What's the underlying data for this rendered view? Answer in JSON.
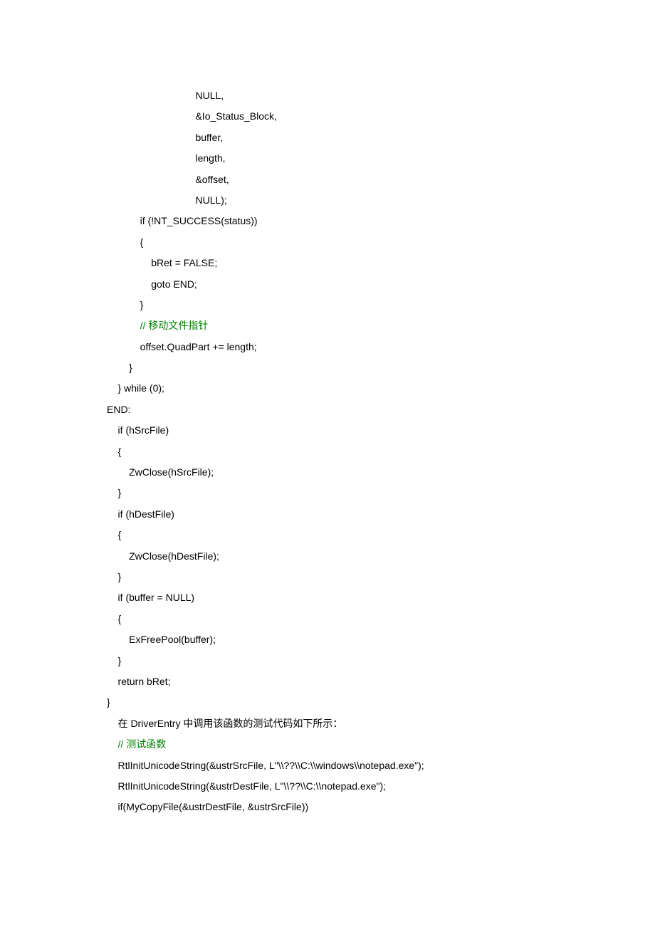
{
  "code": {
    "l1": "                                NULL,",
    "l2": "                                &Io_Status_Block,",
    "l3": "                                buffer,",
    "l4": "                                length,",
    "l5": "                                &offset,",
    "l6": "                                NULL);",
    "l7": "            if (!NT_SUCCESS(status))",
    "l8": "            {",
    "l9": "                bRet = FALSE;",
    "l10": "                goto END;",
    "l11": "            }",
    "l12": "",
    "l13a": "            ",
    "l13b": "// 移动文件指针",
    "l14": "            offset.QuadPart += length;",
    "l15": "        }",
    "l16": "    } while (0);",
    "l17": "END:",
    "l18": "    if (hSrcFile)",
    "l19": "    {",
    "l20": "        ZwClose(hSrcFile);",
    "l21": "    }",
    "l22": "    if (hDestFile)",
    "l23": "    {",
    "l24": "        ZwClose(hDestFile);",
    "l25": "    }",
    "l26": "    if (buffer = NULL)",
    "l27": "    {",
    "l28": "        ExFreePool(buffer);",
    "l29": "    }",
    "l30": "    return bRet;",
    "l31": "}",
    "l32": "    在 DriverEntry 中调用该函数的测试代码如下所示：",
    "l33a": "    ",
    "l33b": "// 测试函数",
    "l34": "    RtlInitUnicodeString(&ustrSrcFile, L\"\\\\??\\\\C:\\\\windows\\\\notepad.exe\");",
    "l35": "    RtlInitUnicodeString(&ustrDestFile, L\"\\\\??\\\\C:\\\\notepad.exe\");",
    "l36": "    if(MyCopyFile(&ustrDestFile, &ustrSrcFile))"
  }
}
